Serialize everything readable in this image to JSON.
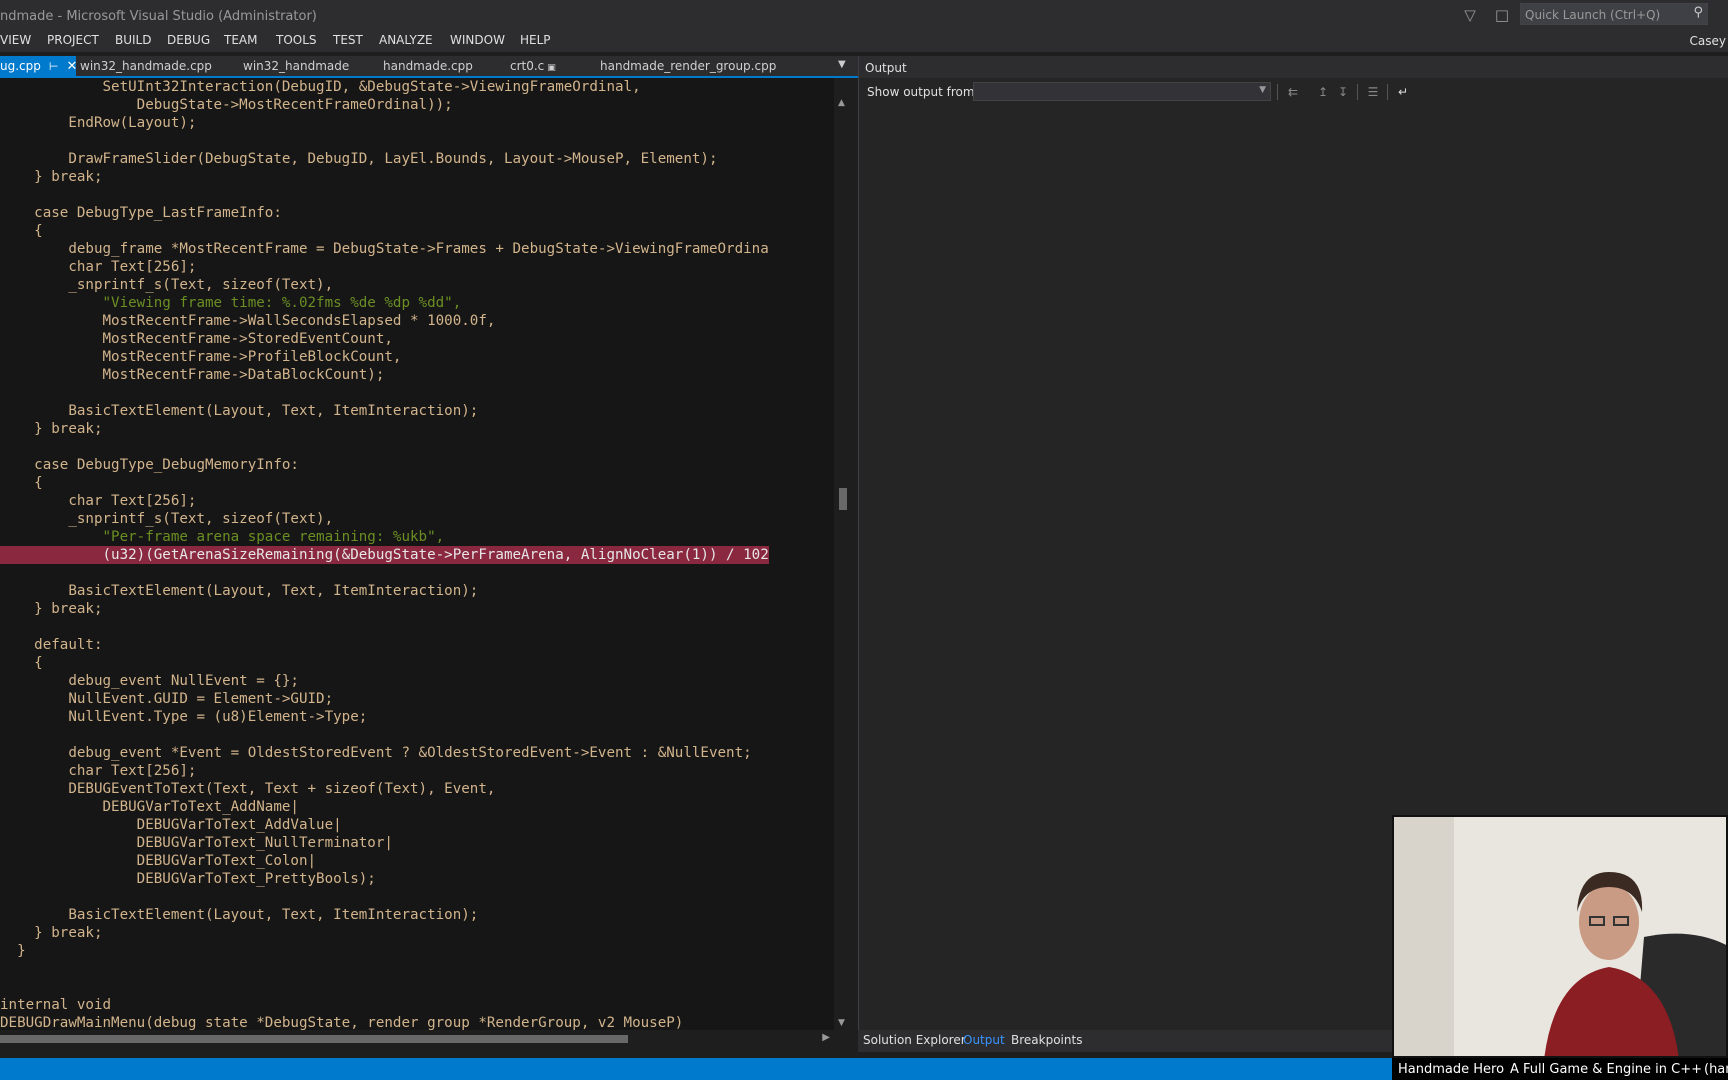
{
  "window": {
    "title": "ndmade - Microsoft Visual Studio (Administrator)",
    "quick_launch_placeholder": "Quick Launch (Ctrl+Q)",
    "user": "Casey"
  },
  "menu": [
    "VIEW",
    "PROJECT",
    "BUILD",
    "DEBUG",
    "TEAM",
    "TOOLS",
    "TEST",
    "ANALYZE",
    "WINDOW",
    "HELP"
  ],
  "tabs": [
    {
      "label": "ug.cpp",
      "active": true
    },
    {
      "label": "win32_handmade.cpp",
      "active": false
    },
    {
      "label": "win32_handmade",
      "active": false
    },
    {
      "label": "handmade.cpp",
      "active": false
    },
    {
      "label": "crt0.c",
      "active": false
    },
    {
      "label": "handmade_render_group.cpp",
      "active": false
    }
  ],
  "code_lines": [
    "            SetUInt32Interaction(DebugID, &DebugState->ViewingFrameOrdinal,",
    "                DebugState->MostRecentFrameOrdinal));",
    "        EndRow(Layout);",
    "",
    "        DrawFrameSlider(DebugState, DebugID, LayEl.Bounds, Layout->MouseP, Element);",
    "    } break;",
    "",
    "    case DebugType_LastFrameInfo:",
    "    {",
    "        debug_frame *MostRecentFrame = DebugState->Frames + DebugState->ViewingFrameOrdina",
    "        char Text[256];",
    "        _snprintf_s(Text, sizeof(Text),",
    "            \"Viewing frame time: %.02fms %de %dp %dd\",",
    "            MostRecentFrame->WallSecondsElapsed * 1000.0f,",
    "            MostRecentFrame->StoredEventCount,",
    "            MostRecentFrame->ProfileBlockCount,",
    "            MostRecentFrame->DataBlockCount);",
    "",
    "        BasicTextElement(Layout, Text, ItemInteraction);",
    "    } break;",
    "",
    "    case DebugType_DebugMemoryInfo:",
    "    {",
    "        char Text[256];",
    "        _snprintf_s(Text, sizeof(Text),",
    "            \"Per-frame arena space remaining: %ukb\",",
    "            (u32)(GetArenaSizeRemaining(&DebugState->PerFrameArena, AlignNoClear(1)) / 102",
    "",
    "        BasicTextElement(Layout, Text, ItemInteraction);",
    "    } break;",
    "",
    "    default:",
    "    {",
    "        debug_event NullEvent = {};",
    "        NullEvent.GUID = Element->GUID;",
    "        NullEvent.Type = (u8)Element->Type;",
    "",
    "        debug_event *Event = OldestStoredEvent ? &OldestStoredEvent->Event : &NullEvent;",
    "        char Text[256];",
    "        DEBUGEventToText(Text, Text + sizeof(Text), Event,",
    "            DEBUGVarToText_AddName|",
    "                DEBUGVarToText_AddValue|",
    "                DEBUGVarToText_NullTerminator|",
    "                DEBUGVarToText_Colon|",
    "                DEBUGVarToText_PrettyBools);",
    "",
    "        BasicTextElement(Layout, Text, ItemInteraction);",
    "    } break;",
    "  }",
    "",
    "",
    "internal void",
    "DEBUGDrawMainMenu(debug_state *DebugState, render_group *RenderGroup, v2 MouseP)"
  ],
  "highlight_line_index": 26,
  "output_panel": {
    "title": "Output",
    "show_output_label": "Show output from:",
    "selected_source": ""
  },
  "bottom_tabs": [
    {
      "label": "Solution Explorer",
      "active": false
    },
    {
      "label": "Output",
      "active": true
    },
    {
      "label": "Breakpoints",
      "active": false
    }
  ],
  "webcam_caption": {
    "left": "Handmade Hero",
    "mid": "A Full Game & Engine in C++",
    "right": "(han"
  },
  "colors": {
    "accent": "#007acc",
    "highlight_line": "#8a2840",
    "editor_bg": "#161616"
  }
}
